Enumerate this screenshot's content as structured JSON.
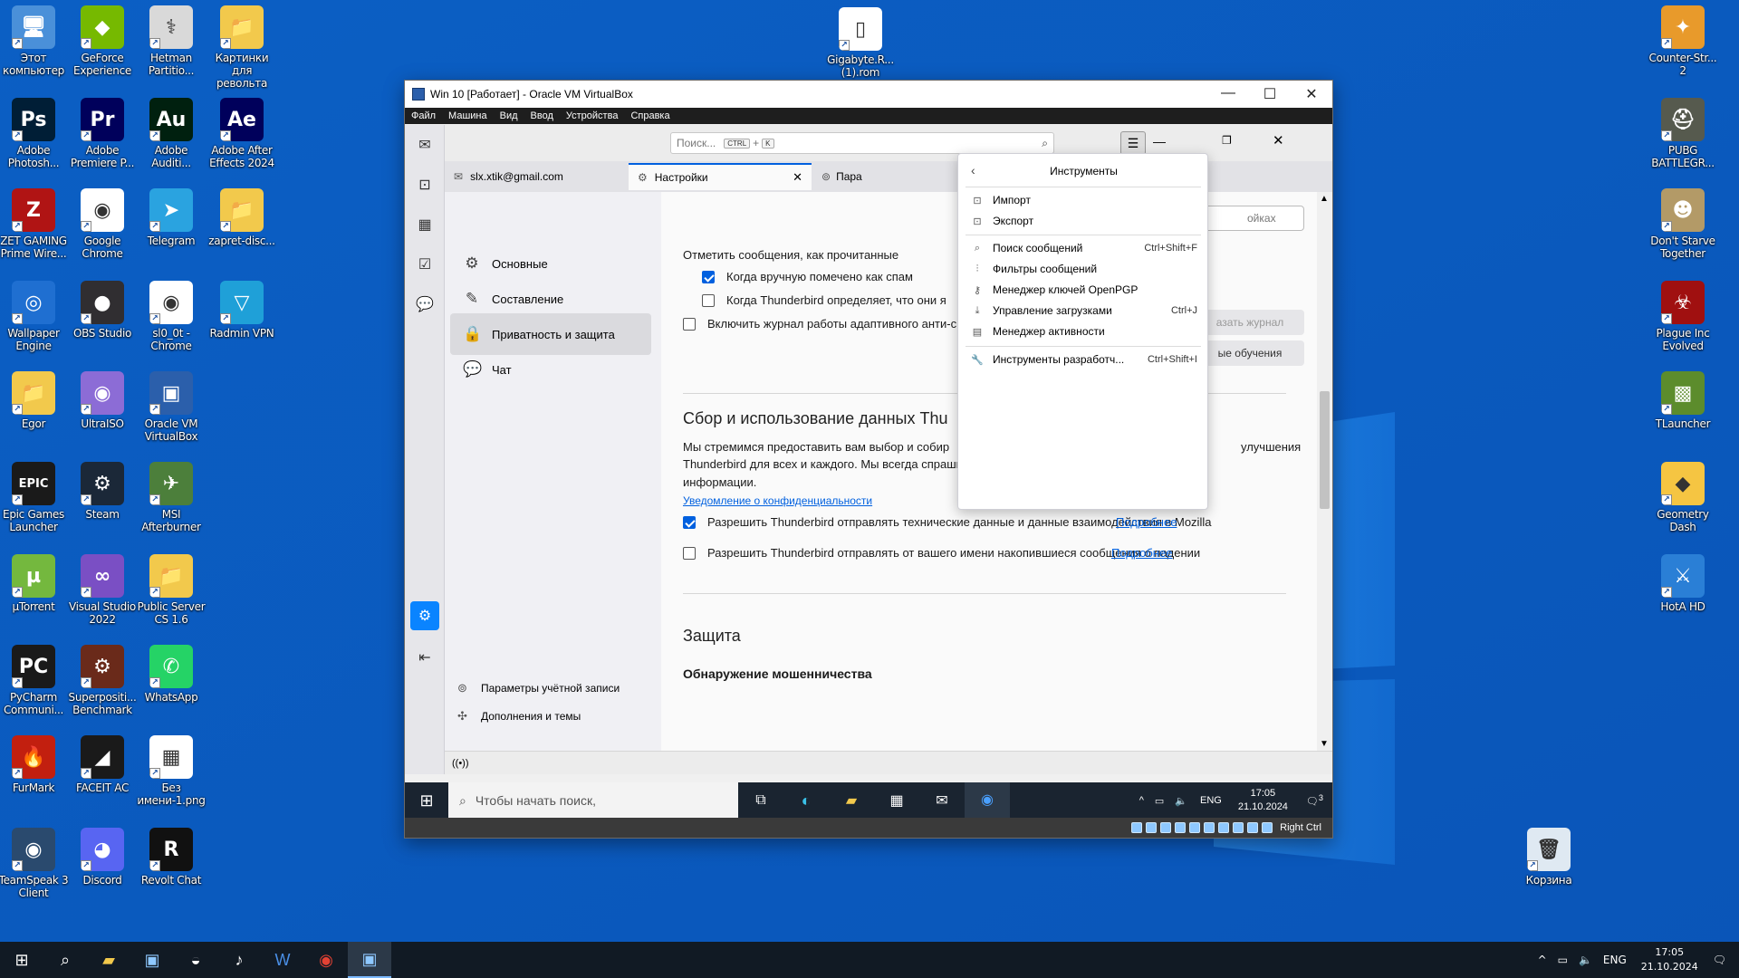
{
  "desktop_icons": [
    {
      "label": "Этот компьютер",
      "glyph": "🖥",
      "color": "#4a90d9"
    },
    {
      "label": "GeForce Experience",
      "glyph": "◆",
      "color": "#76b900"
    },
    {
      "label": "Hetman Partitio...",
      "glyph": "⚕",
      "color": "#d9d9d9"
    },
    {
      "label": "Картинки для револьта",
      "glyph": "📁",
      "color": "#f2c94c"
    },
    {
      "label": "Adobe Photosh...",
      "glyph": "Ps",
      "color": "#001e36"
    },
    {
      "label": "Adobe Premiere P...",
      "glyph": "Pr",
      "color": "#00005b"
    },
    {
      "label": "Adobe Auditi...",
      "glyph": "Au",
      "color": "#00200f"
    },
    {
      "label": "Adobe After Effects 2024",
      "glyph": "Ae",
      "color": "#00005b"
    },
    {
      "label": "ZET GAMING Prime Wire...",
      "glyph": "Z",
      "color": "#b01414"
    },
    {
      "label": "Google Chrome",
      "glyph": "◉",
      "color": "#ffffff"
    },
    {
      "label": "Telegram",
      "glyph": "➤",
      "color": "#2aa3e0"
    },
    {
      "label": "zapret-disc...",
      "glyph": "📁",
      "color": "#f2c94c"
    },
    {
      "label": "Wallpaper Engine",
      "glyph": "◎",
      "color": "#1f6fd1"
    },
    {
      "label": "OBS Studio",
      "glyph": "●",
      "color": "#302e31"
    },
    {
      "label": "sl0_0t - Chrome",
      "glyph": "◉",
      "color": "#ffffff"
    },
    {
      "label": "Radmin VPN",
      "glyph": "▽",
      "color": "#1fa0d8"
    },
    {
      "label": "Egor",
      "glyph": "📁",
      "color": "#f2c94c"
    },
    {
      "label": "UltraISO",
      "glyph": "◉",
      "color": "#8c6cd6"
    },
    {
      "label": "Oracle VM VirtualBox",
      "glyph": "▣",
      "color": "#2b5fab"
    },
    {
      "label": "Epic Games Launcher",
      "glyph": "EPIC",
      "color": "#1a1a1a"
    },
    {
      "label": "Steam",
      "glyph": "⚙",
      "color": "#1b2838"
    },
    {
      "label": "MSI Afterburner",
      "glyph": "✈",
      "color": "#4c7f3b"
    },
    {
      "label": "µTorrent",
      "glyph": "µ",
      "color": "#74b83e"
    },
    {
      "label": "Visual Studio 2022",
      "glyph": "∞",
      "color": "#7a4fc4"
    },
    {
      "label": "Public Server CS 1.6",
      "glyph": "📁",
      "color": "#f2c94c"
    },
    {
      "label": "PyCharm Communi...",
      "glyph": "PC",
      "color": "#1a1a1a"
    },
    {
      "label": "Superpositi... Benchmark",
      "glyph": "⚙",
      "color": "#6a2a1a"
    },
    {
      "label": "WhatsApp",
      "glyph": "✆",
      "color": "#25d366"
    },
    {
      "label": "FurMark",
      "glyph": "🔥",
      "color": "#c21f0f"
    },
    {
      "label": "FACEIT AC",
      "glyph": "◢",
      "color": "#1a1a1a"
    },
    {
      "label": "Без имени-1.png",
      "glyph": "▦",
      "color": "#ffffff"
    },
    {
      "label": "TeamSpeak 3 Client",
      "glyph": "◉",
      "color": "#2a4a6e"
    },
    {
      "label": "Discord",
      "glyph": "◕",
      "color": "#5865f2"
    },
    {
      "label": "Revolt Chat",
      "glyph": "R",
      "color": "#111111"
    },
    {
      "label": "Gigabyte.R... (1).rom",
      "glyph": "▯",
      "color": "#ffffff"
    },
    {
      "label": "Counter-Str... 2",
      "glyph": "✦",
      "color": "#e89a2b"
    },
    {
      "label": "PUBG BATTLEGR...",
      "glyph": "⛑",
      "color": "#565a4e"
    },
    {
      "label": "Don't Starve Together",
      "glyph": "☻",
      "color": "#b39a67"
    },
    {
      "label": "Plague Inc Evolved",
      "glyph": "☣",
      "color": "#a01010"
    },
    {
      "label": "TLauncher",
      "glyph": "▩",
      "color": "#5c8c2c"
    },
    {
      "label": "Geometry Dash",
      "glyph": "◆",
      "color": "#f5c542"
    },
    {
      "label": "HotA HD",
      "glyph": "⚔",
      "color": "#2a7fd6"
    },
    {
      "label": "Корзина",
      "glyph": "🗑",
      "color": "#dfe9f2"
    }
  ],
  "vm": {
    "title": "Win 10 [Работает] - Oracle VM VirtualBox",
    "menu": [
      "Файл",
      "Машина",
      "Вид",
      "Ввод",
      "Устройства",
      "Справка"
    ],
    "host_key": "Right Ctrl"
  },
  "thunderbird": {
    "search_placeholder": "Поиск...",
    "search_kbd1": "CTRL",
    "search_plus": "+",
    "search_kbd2": "K",
    "tab_mail": "slx.xtik@gmail.com",
    "tab_settings": "Настройки",
    "tab_third": "Пара",
    "nav": [
      "Основные",
      "Составление",
      "Приватность и защита",
      "Чат"
    ],
    "nav_bottom": [
      "Параметры учётной записи",
      "Дополнения и темы"
    ],
    "content": {
      "mark_read": "Отметить сообщения, как прочитанные",
      "cb_spam": "Когда вручную помечено как спам",
      "cb_tb": "Когда Thunderbird определяет, что они я",
      "cb_log": "Включить журнал работы адаптивного анти-с",
      "search_frag": "ойках",
      "btn_log": "азать журнал",
      "btn_train": "ые обучения",
      "h_data": "Сбор и использование данных Thu",
      "p1": "Мы стремимся предоставить вам выбор и собир",
      "p1_tail": "улучшения",
      "p2": "Thunderbird для всех и каждого. Мы всегда спрашиваем разрешение перед получением личной",
      "p3": "информации.",
      "privacy_link": "Уведомление о конфиденциальности",
      "cb_tech": "Разрешить Thunderbird отправлять технические данные и данные взаимодействия в Mozilla",
      "more1": "Подробнее",
      "cb_crash": "Разрешить Thunderbird отправлять от вашего имени накопившиеся сообщения о падении",
      "more2": "Подробнее",
      "h_protect": "Защита",
      "h_fraud": "Обнаружение мошенничества"
    },
    "tools_menu": {
      "title": "Инструменты",
      "items": [
        {
          "label": "Импорт",
          "shortcut": ""
        },
        {
          "label": "Экспорт",
          "shortcut": ""
        },
        {
          "label": "Поиск сообщений",
          "shortcut": "Ctrl+Shift+F"
        },
        {
          "label": "Фильтры сообщений",
          "shortcut": ""
        },
        {
          "label": "Менеджер ключей OpenPGP",
          "shortcut": ""
        },
        {
          "label": "Управление загрузками",
          "shortcut": "Ctrl+J"
        },
        {
          "label": "Менеджер активности",
          "shortcut": ""
        },
        {
          "label": "Инструменты разработч...",
          "shortcut": "Ctrl+Shift+I"
        }
      ]
    }
  },
  "guest_taskbar": {
    "search_text": "Чтобы начать поиск,",
    "lang": "ENG",
    "time": "17:05",
    "date": "21.10.2024",
    "notif_count": "3"
  },
  "host_taskbar": {
    "lang": "ENG",
    "time": "17:05",
    "date": "21.10.2024"
  }
}
